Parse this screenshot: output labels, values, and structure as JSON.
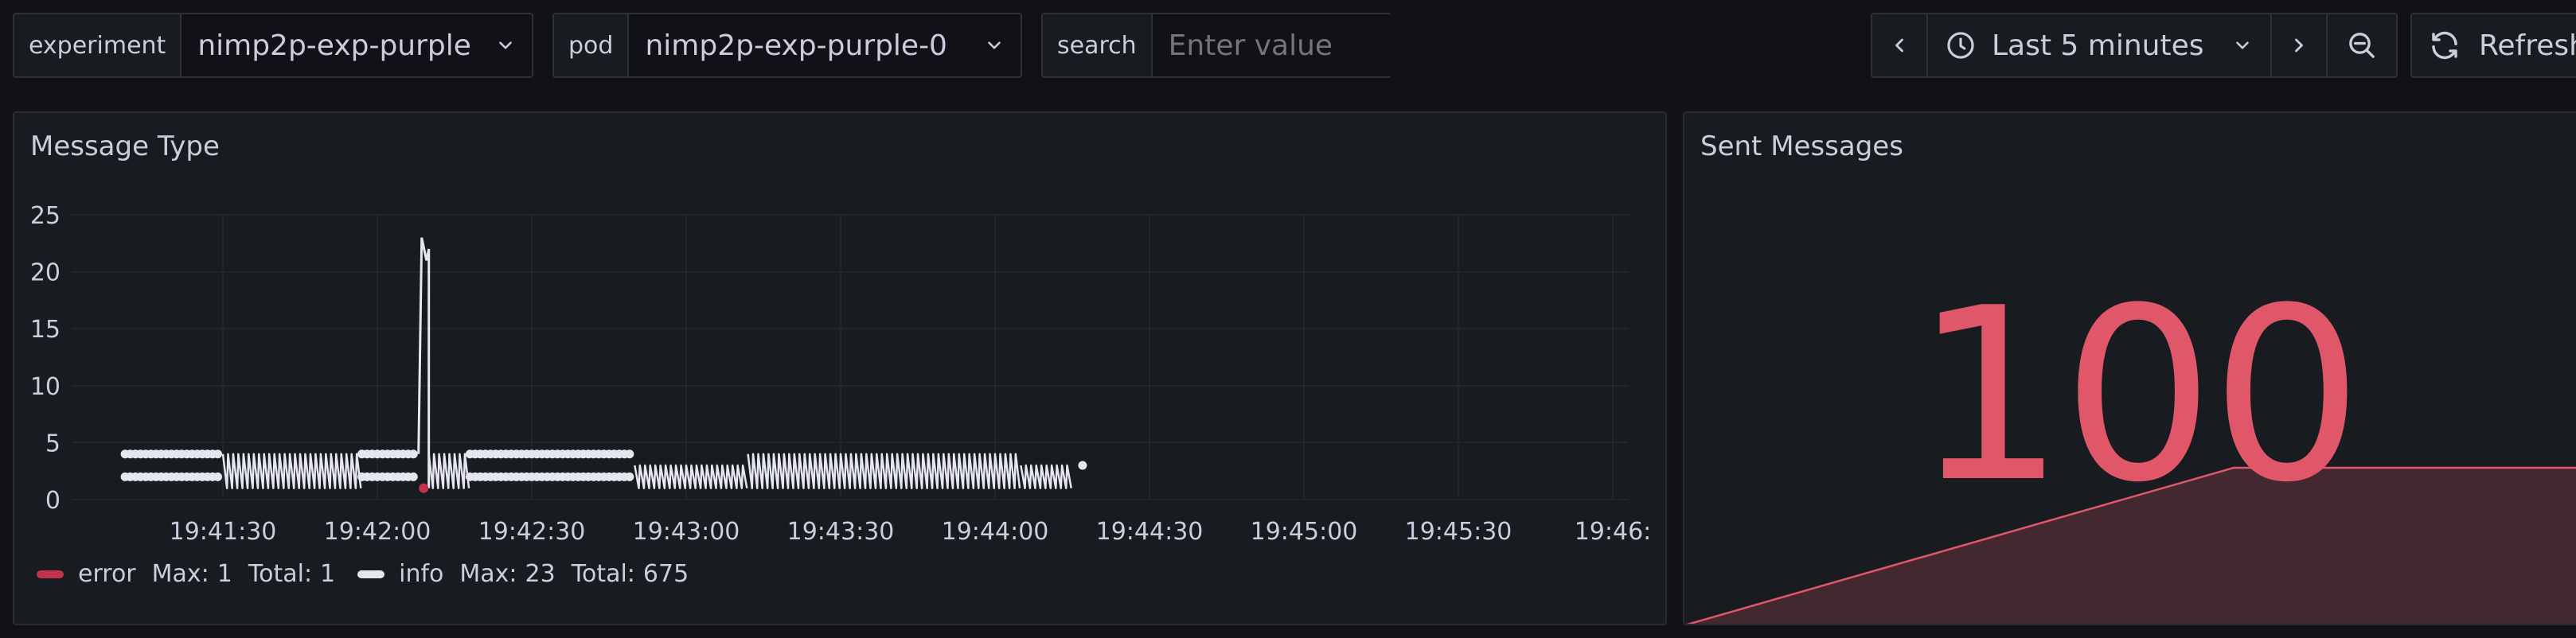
{
  "variables": {
    "experiment": {
      "label": "experiment",
      "value": "nimp2p-exp-purple"
    },
    "pod": {
      "label": "pod",
      "value": "nimp2p-exp-purple-0"
    },
    "search": {
      "label": "search",
      "placeholder": "Enter value"
    }
  },
  "time_picker": {
    "range": "Last 5 minutes"
  },
  "refresh": {
    "label": "Refresh"
  },
  "panels": {
    "message_type": {
      "title": "Message Type",
      "legend": [
        {
          "name": "error",
          "max_label": "Max:",
          "max": "1",
          "total_label": "Total:",
          "total": "1",
          "color": "#c4314b"
        },
        {
          "name": "info",
          "max_label": "Max:",
          "max": "23",
          "total_label": "Total:",
          "total": "675",
          "color": "#e6e6ef"
        }
      ]
    },
    "sent_messages": {
      "title": "Sent Messages",
      "value": "100",
      "color": "#e05769"
    }
  },
  "chart_data": {
    "type": "line",
    "title": "Message Type",
    "xlabel": "",
    "ylabel": "",
    "ylim": [
      0,
      25
    ],
    "yticks": [
      "0",
      "5",
      "10",
      "15",
      "20",
      "25"
    ],
    "xticks": [
      "19:41:30",
      "19:42:00",
      "19:42:30",
      "19:43:00",
      "19:43:30",
      "19:44:00",
      "19:44:30",
      "19:45:00",
      "19:45:30",
      "19:46:"
    ],
    "grid": true,
    "legend_position": "bottom-left",
    "series": [
      {
        "name": "info",
        "color": "#e6e6ef",
        "segments": [
          {
            "style": "points",
            "x_start": "19:41:11",
            "x_end": "19:41:29",
            "pattern": [
              2,
              4
            ]
          },
          {
            "style": "sawtooth",
            "x_start": "19:41:30",
            "x_end": "19:41:57",
            "min": 1,
            "max": 4
          },
          {
            "style": "points",
            "x_start": "19:41:57",
            "x_end": "19:42:07",
            "pattern": [
              2,
              4
            ]
          },
          {
            "style": "spike",
            "x_start": "19:42:08",
            "x_end": "19:42:10",
            "max": 23
          },
          {
            "style": "sawtooth",
            "x_start": "19:42:10",
            "x_end": "19:42:18",
            "min": 1,
            "max": 4
          },
          {
            "style": "points",
            "x_start": "19:42:18",
            "x_end": "19:42:49",
            "pattern": [
              2,
              4
            ]
          },
          {
            "style": "sawtooth",
            "x_start": "19:42:50",
            "x_end": "19:43:12",
            "min": 1,
            "max": 3
          },
          {
            "style": "sawtooth",
            "x_start": "19:43:12",
            "x_end": "19:44:05",
            "min": 1,
            "max": 4
          },
          {
            "style": "sawtooth",
            "x_start": "19:44:05",
            "x_end": "19:44:15",
            "min": 1,
            "max": 3
          }
        ]
      },
      {
        "name": "error",
        "color": "#c4314b",
        "points": [
          {
            "x": "19:42:09",
            "y": 1
          }
        ]
      }
    ]
  }
}
